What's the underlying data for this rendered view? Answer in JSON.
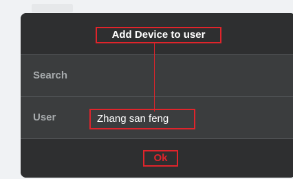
{
  "dialog": {
    "title": "Add Device to user",
    "search": {
      "label": "Search",
      "value": "",
      "placeholder": ""
    },
    "user": {
      "label": "User",
      "value": "Zhang san feng"
    },
    "ok_label": "Ok"
  },
  "colors": {
    "highlight": "#e0242b",
    "dialog_background": "#3b3d3e",
    "header_background": "#2e2f30",
    "label_text": "#a7abad"
  }
}
